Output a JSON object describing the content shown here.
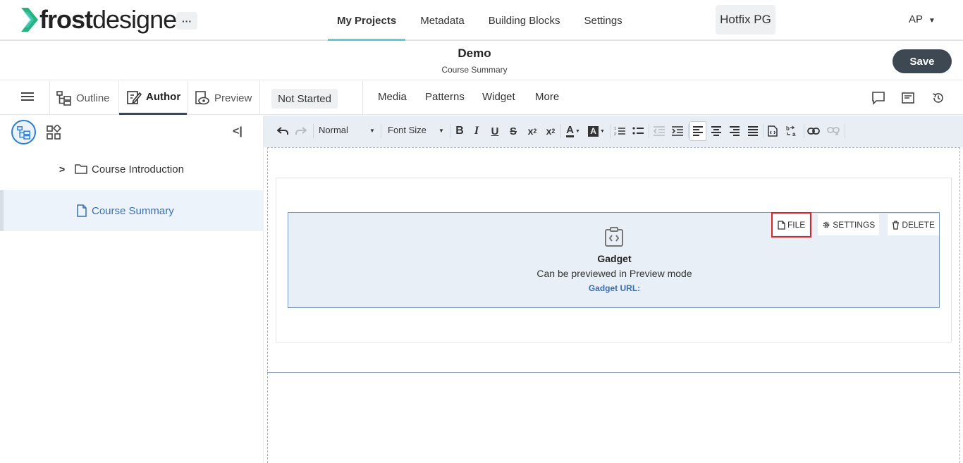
{
  "app": {
    "logo_bold": "frost",
    "logo_light": "designer",
    "more": "···"
  },
  "nav": {
    "items": [
      "My Projects",
      "Metadata",
      "Building Blocks",
      "Settings"
    ],
    "active": "My Projects"
  },
  "project": {
    "name": "Hotfix PG"
  },
  "user": {
    "initials": "AP"
  },
  "header": {
    "title": "Demo",
    "subtitle": "Course Summary",
    "save_label": "Save"
  },
  "modes": {
    "outline": "Outline",
    "author": "Author",
    "preview": "Preview",
    "status": "Not Started"
  },
  "insert_menu": {
    "media": "Media",
    "patterns": "Patterns",
    "widget": "Widget",
    "more": "More"
  },
  "editor": {
    "block_format": "Normal",
    "font_size": "Font Size"
  },
  "tree": {
    "items": [
      {
        "label": "Course Introduction",
        "type": "folder"
      },
      {
        "label": "Course Summary",
        "type": "page",
        "selected": true
      }
    ]
  },
  "gadget": {
    "file": "FILE",
    "settings": "SETTINGS",
    "delete": "DELETE",
    "title": "Gadget",
    "description": "Can be previewed in Preview mode",
    "url_label": "Gadget URL:"
  },
  "colors": {
    "accent": "#5ccfd8",
    "primary_dark": "#3d4852",
    "link": "#3a6fb0",
    "highlight": "#d9262b",
    "logo_green": "#2ecc71"
  }
}
